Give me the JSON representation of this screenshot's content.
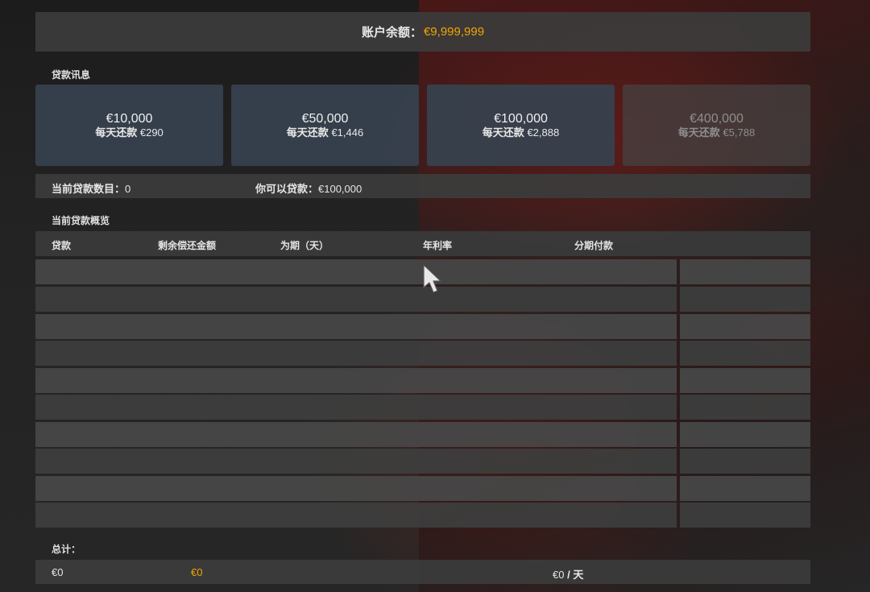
{
  "balance": {
    "label": "账户余额：",
    "value": "€9,999,999"
  },
  "loan_info_label": "贷款讯息",
  "loan_options": [
    {
      "amount": "€10,000",
      "daily_label": "每天还款",
      "daily_value": "€290",
      "enabled": true
    },
    {
      "amount": "€50,000",
      "daily_label": "每天还款",
      "daily_value": "€1,446",
      "enabled": true
    },
    {
      "amount": "€100,000",
      "daily_label": "每天还款",
      "daily_value": "€2,888",
      "enabled": true
    },
    {
      "amount": "€400,000",
      "daily_label": "每天还款",
      "daily_value": "€5,788",
      "enabled": false
    }
  ],
  "current_loans": {
    "label": "当前贷款数目：",
    "value": "0"
  },
  "available_loan": {
    "label": "你可以贷款：",
    "value": "€100,000"
  },
  "overview_label": "当前贷款概览",
  "table": {
    "columns": [
      "贷款",
      "剩余偿还金额",
      "为期（天）",
      "年利率",
      "分期付款"
    ],
    "rows": [
      {},
      {},
      {},
      {},
      {},
      {},
      {},
      {},
      {},
      {}
    ]
  },
  "totals": {
    "label": "总计：",
    "loan_total": "€0",
    "remaining_total": "€0",
    "installment_value": "€0",
    "installment_unit": "/ 天"
  },
  "colors": {
    "accent": "#f0a500",
    "card_bg": "#37414e",
    "panel_bg": "#3c3c3c"
  }
}
